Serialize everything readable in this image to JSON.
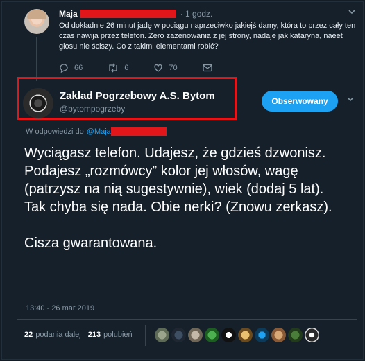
{
  "parent_tweet": {
    "name": "Maja",
    "time": "· 1 godz.",
    "text": "Od dokładnie 26 minut jadę w pociągu naprzeciwko jakiejś damy, która to przez cały ten czas nawija przez telefon. Zero zażenowania z jej strony, nadaje jak kataryna, naeet głosu nie ściszy. Co z takimi elementami robić?",
    "replies": "66",
    "retweets": "6",
    "likes": "70"
  },
  "main_tweet": {
    "author_name": "Zakład Pogrzebowy A.S. Bytom",
    "author_handle": "@bytompogrzeby",
    "follow_label": "Obserwowany",
    "reply_prefix": "W odpowiedzi do",
    "reply_mention": "@Maja",
    "text": "Wyciągasz telefon. Udajesz, że gdzieś dzwonisz. Podajesz „rozmówcy” kolor jej włosów, wagę (patrzysz na nią sugestywnie), wiek (dodaj 5 lat).\nTak chyba się nada. Obie nerki? (Znowu zerkasz).\n\nCisza gwarantowana.",
    "timestamp": "13:40 - 26 mar 2019",
    "retweet_count": "22",
    "retweet_label": "podania dalej",
    "like_count": "213",
    "like_label": "polubień"
  },
  "colors": {
    "background": "#15202b",
    "accent": "#1da1f2",
    "redaction": "#e0161b",
    "muted": "#8899a6"
  },
  "icons": [
    "reply-icon",
    "retweet-icon",
    "heart-icon",
    "message-icon",
    "chevron-down-icon"
  ]
}
